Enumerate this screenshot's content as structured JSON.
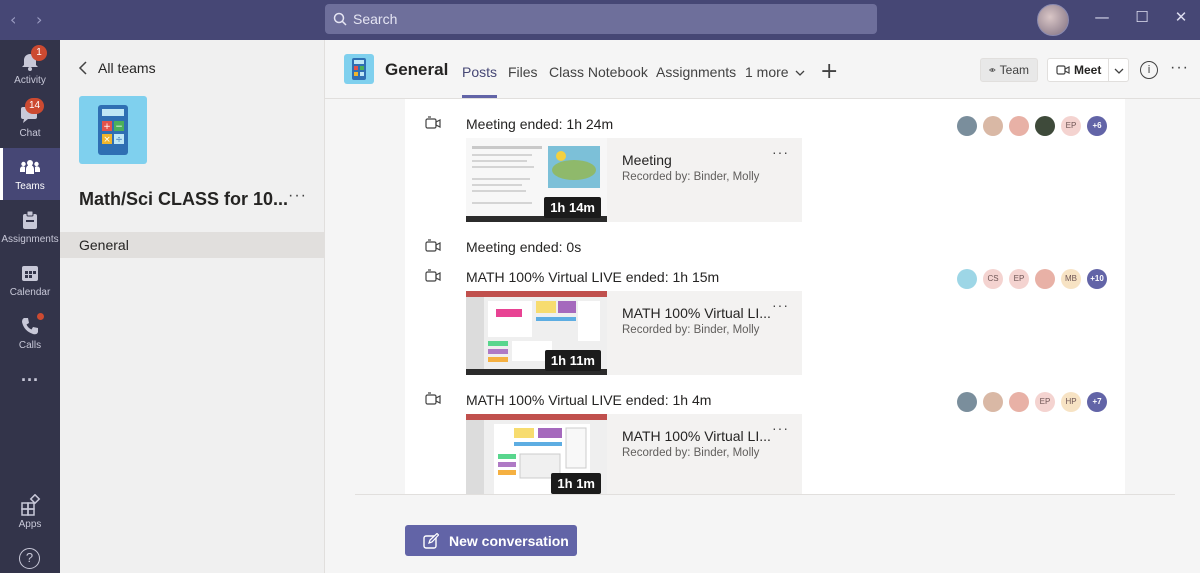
{
  "titlebar": {
    "search_placeholder": "Search",
    "back_arrow": "‹",
    "forward_arrow": "›",
    "minimize": "—",
    "maximize": "☐",
    "close": "✕"
  },
  "rail": [
    {
      "label": "Activity",
      "badge": "1"
    },
    {
      "label": "Chat",
      "badge": "14"
    },
    {
      "label": "Teams"
    },
    {
      "label": "Assignments"
    },
    {
      "label": "Calendar"
    },
    {
      "label": "Calls"
    },
    {
      "label": "···"
    },
    {
      "label": "Apps"
    },
    {
      "label": "?"
    }
  ],
  "teampanel": {
    "back_label": "All teams",
    "team_name": "Math/Sci CLASS for 10...",
    "more": "···",
    "channels": [
      "General"
    ]
  },
  "header": {
    "channel_title": "General",
    "tabs": [
      "Posts",
      "Files",
      "Class Notebook",
      "Assignments",
      "1 more"
    ],
    "plus": "+",
    "team_button": "Team",
    "meet_button": "Meet",
    "info": "i",
    "more": "···"
  },
  "messages": [
    {
      "text": "Meeting ended: 1h 24m",
      "participants": [
        "",
        "",
        "",
        "",
        "EP"
      ],
      "more_count": "+6",
      "card": {
        "title": "Meeting",
        "subtitle": "Recorded by: Binder, Molly",
        "duration": "1h 14m",
        "more": "···"
      }
    },
    {
      "text": "Meeting ended: 0s"
    },
    {
      "text": "MATH 100% Virtual LIVE ended: 1h 15m",
      "participants": [
        "",
        "CS",
        "EP",
        "",
        "MB"
      ],
      "more_count": "+10",
      "card": {
        "title": "MATH 100% Virtual LI...",
        "subtitle": "Recorded by: Binder, Molly",
        "duration": "1h 11m",
        "more": "···"
      }
    },
    {
      "text": "MATH 100% Virtual LIVE ended: 1h 4m",
      "participants": [
        "",
        "",
        "",
        "EP",
        "HP"
      ],
      "more_count": "+7",
      "card": {
        "title": "MATH 100% Virtual LI...",
        "subtitle": "Recorded by: Binder, Molly",
        "duration": "1h 1m",
        "more": "···"
      }
    }
  ],
  "new_conversation": "New conversation",
  "colors": {
    "titlebar": "#464775",
    "rail": "#33344a",
    "accent": "#6264a7",
    "badge": "#cc4a31",
    "team_logo": "#7fd0ee"
  }
}
